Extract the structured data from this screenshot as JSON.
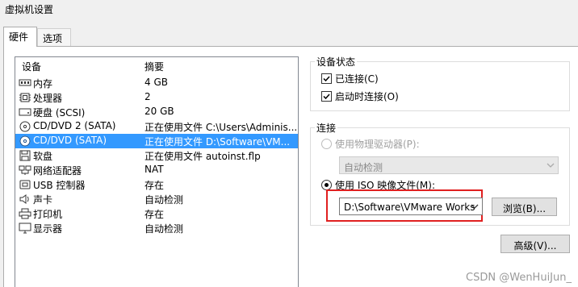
{
  "window": {
    "title": "虚拟机设置"
  },
  "tabs": [
    {
      "label": "硬件",
      "active": true
    },
    {
      "label": "选项",
      "active": false
    }
  ],
  "device_list": {
    "headers": {
      "device": "设备",
      "summary": "摘要"
    },
    "rows": [
      {
        "icon": "memory-icon",
        "name": "内存",
        "summary": "4 GB"
      },
      {
        "icon": "processor-icon",
        "name": "处理器",
        "summary": "2"
      },
      {
        "icon": "hard-disk-icon",
        "name": "硬盘 (SCSI)",
        "summary": "20 GB"
      },
      {
        "icon": "cd-dvd-icon",
        "name": "CD/DVD 2 (SATA)",
        "summary": "正在使用文件 C:\\Users\\Adminis..."
      },
      {
        "icon": "cd-dvd-icon",
        "name": "CD/DVD (SATA)",
        "summary": "正在使用文件 D:\\Software\\VM...",
        "selected": true
      },
      {
        "icon": "floppy-icon",
        "name": "软盘",
        "summary": "正在使用文件 autoinst.flp"
      },
      {
        "icon": "network-adapter-icon",
        "name": "网络适配器",
        "summary": "NAT"
      },
      {
        "icon": "usb-icon",
        "name": "USB 控制器",
        "summary": "存在"
      },
      {
        "icon": "sound-card-icon",
        "name": "声卡",
        "summary": "自动检测"
      },
      {
        "icon": "printer-icon",
        "name": "打印机",
        "summary": "存在"
      },
      {
        "icon": "display-icon",
        "name": "显示器",
        "summary": "自动检测"
      }
    ]
  },
  "device_status": {
    "title": "设备状态",
    "connected": {
      "label": "已连接(C)",
      "checked": true
    },
    "connect_at_power_on": {
      "label": "启动时连接(O)",
      "checked": true
    }
  },
  "connection": {
    "title": "连接",
    "physical_drive": {
      "label": "使用物理驱动器(P):",
      "selected": false,
      "enabled": false,
      "value": "自动检测"
    },
    "iso_image": {
      "label": "使用 ISO 映像文件(M):",
      "selected": true,
      "value": "D:\\Software\\VMware Works"
    },
    "browse_label": "浏览(B)..."
  },
  "advanced_label": "高级(V)...",
  "watermark": "CSDN @WenHuiJun_",
  "colors": {
    "selection": "#3399ff",
    "highlight_border": "#e02020"
  }
}
